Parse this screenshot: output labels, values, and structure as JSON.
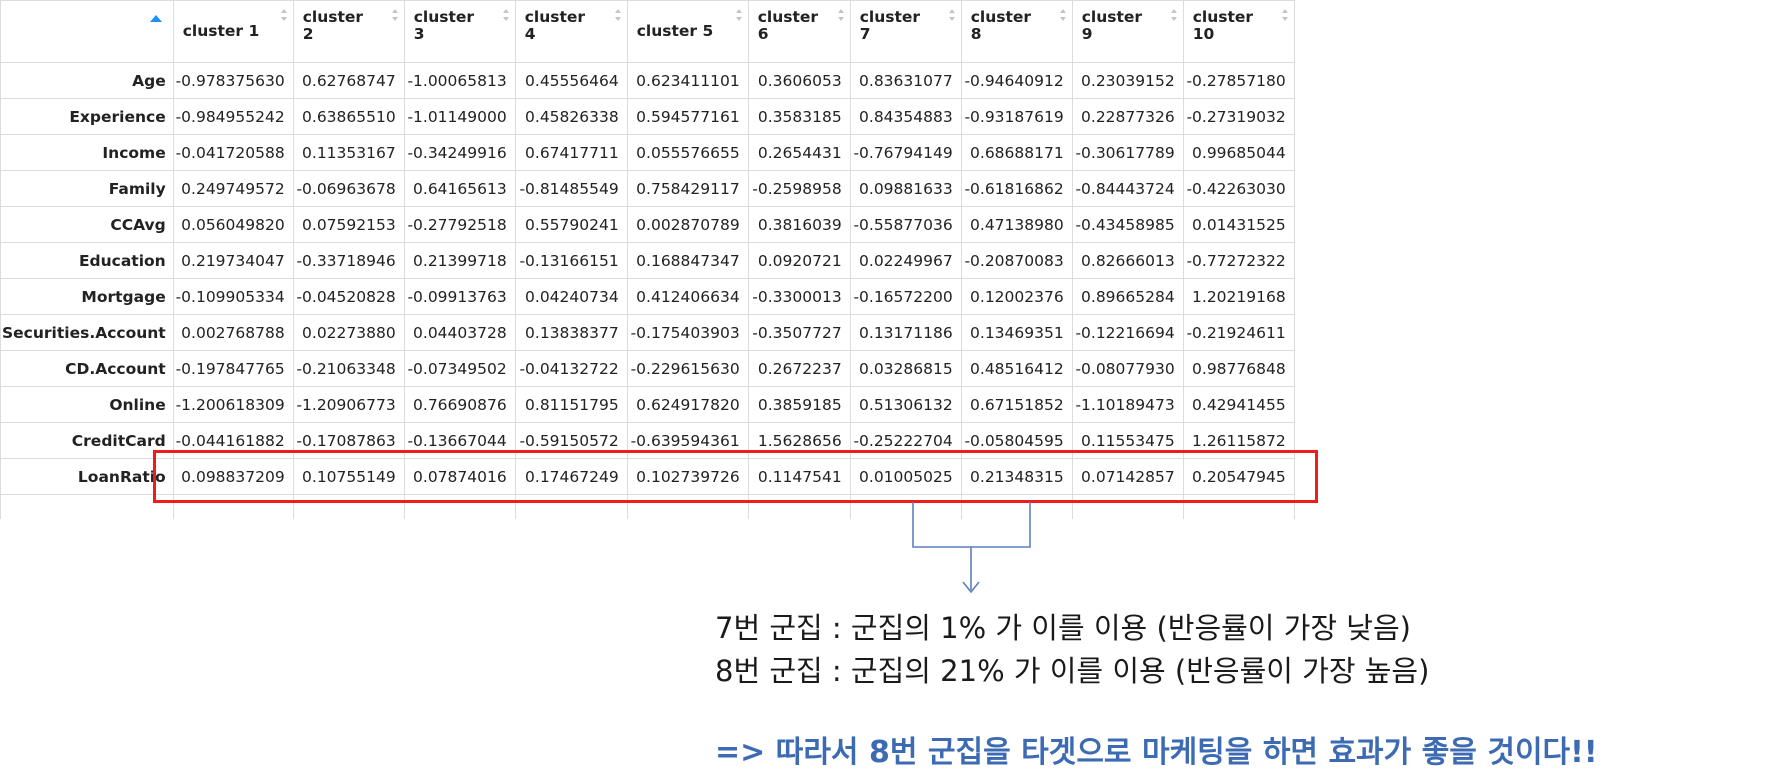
{
  "table": {
    "columns": [
      {
        "label1": "cluster 1",
        "label2": ""
      },
      {
        "label1": "cluster",
        "label2": "2"
      },
      {
        "label1": "cluster",
        "label2": "3"
      },
      {
        "label1": "cluster",
        "label2": "4"
      },
      {
        "label1": "cluster 5",
        "label2": ""
      },
      {
        "label1": "cluster",
        "label2": "6"
      },
      {
        "label1": "cluster",
        "label2": "7"
      },
      {
        "label1": "cluster",
        "label2": "8"
      },
      {
        "label1": "cluster",
        "label2": "9"
      },
      {
        "label1": "cluster",
        "label2": "10"
      }
    ],
    "rows": [
      {
        "name": "Age",
        "values": [
          "-0.978375630",
          "0.62768747",
          "-1.00065813",
          "0.45556464",
          "0.623411101",
          "0.3606053",
          "0.83631077",
          "-0.94640912",
          "0.23039152",
          "-0.27857180"
        ]
      },
      {
        "name": "Experience",
        "values": [
          "-0.984955242",
          "0.63865510",
          "-1.01149000",
          "0.45826338",
          "0.594577161",
          "0.3583185",
          "0.84354883",
          "-0.93187619",
          "0.22877326",
          "-0.27319032"
        ]
      },
      {
        "name": "Income",
        "values": [
          "-0.041720588",
          "0.11353167",
          "-0.34249916",
          "0.67417711",
          "0.055576655",
          "0.2654431",
          "-0.76794149",
          "0.68688171",
          "-0.30617789",
          "0.99685044"
        ]
      },
      {
        "name": "Family",
        "values": [
          "0.249749572",
          "-0.06963678",
          "0.64165613",
          "-0.81485549",
          "0.758429117",
          "-0.2598958",
          "0.09881633",
          "-0.61816862",
          "-0.84443724",
          "-0.42263030"
        ]
      },
      {
        "name": "CCAvg",
        "values": [
          "0.056049820",
          "0.07592153",
          "-0.27792518",
          "0.55790241",
          "0.002870789",
          "0.3816039",
          "-0.55877036",
          "0.47138980",
          "-0.43458985",
          "0.01431525"
        ]
      },
      {
        "name": "Education",
        "values": [
          "0.219734047",
          "-0.33718946",
          "0.21399718",
          "-0.13166151",
          "0.168847347",
          "0.0920721",
          "0.02249967",
          "-0.20870083",
          "0.82666013",
          "-0.77272322"
        ]
      },
      {
        "name": "Mortgage",
        "values": [
          "-0.109905334",
          "-0.04520828",
          "-0.09913763",
          "0.04240734",
          "0.412406634",
          "-0.3300013",
          "-0.16572200",
          "0.12002376",
          "0.89665284",
          "1.20219168"
        ]
      },
      {
        "name": "Securities.Account",
        "values": [
          "0.002768788",
          "0.02273880",
          "0.04403728",
          "0.13838377",
          "-0.175403903",
          "-0.3507727",
          "0.13171186",
          "0.13469351",
          "-0.12216694",
          "-0.21924611"
        ]
      },
      {
        "name": "CD.Account",
        "values": [
          "-0.197847765",
          "-0.21063348",
          "-0.07349502",
          "-0.04132722",
          "-0.229615630",
          "0.2672237",
          "0.03286815",
          "0.48516412",
          "-0.08077930",
          "0.98776848"
        ]
      },
      {
        "name": "Online",
        "values": [
          "-1.200618309",
          "-1.20906773",
          "0.76690876",
          "0.81151795",
          "0.624917820",
          "0.3859185",
          "0.51306132",
          "0.67151852",
          "-1.10189473",
          "0.42941455"
        ]
      },
      {
        "name": "CreditCard",
        "values": [
          "-0.044161882",
          "-0.17087863",
          "-0.13667044",
          "-0.59150572",
          "-0.639594361",
          "1.5628656",
          "-0.25222704",
          "-0.05804595",
          "0.11553475",
          "1.26115872"
        ]
      },
      {
        "name": "LoanRatio",
        "values": [
          "0.098837209",
          "0.10755149",
          "0.07874016",
          "0.17467249",
          "0.102739726",
          "0.1147541",
          "0.01005025",
          "0.21348315",
          "0.07142857",
          "0.20547945"
        ]
      }
    ]
  },
  "annotation": {
    "line1": "7번 군집 : 군집의 1% 가 이를 이용  (반응률이 가장 낮음)",
    "line2": "8번 군집 : 군집의 21% 가 이를 이용 (반응률이 가장 높음)",
    "conclusion": "=> 따라서 8번 군집을 타겟으로 마케팅을 하면 효과가 좋을 것이다!!"
  },
  "colors": {
    "highlight": "#ee1c1c",
    "connector": "#5b7fbf",
    "conclusion": "#3d6bb3"
  }
}
